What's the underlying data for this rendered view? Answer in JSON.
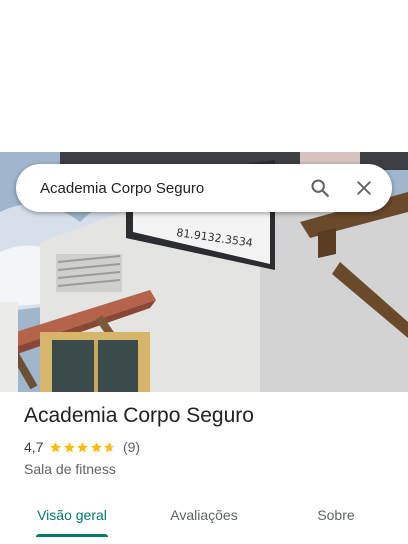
{
  "search": {
    "query": "Academia Corpo Seguro",
    "search_icon": "search-icon",
    "close_icon": "close-icon"
  },
  "photo": {
    "sign_text": "81.9132.3534"
  },
  "place": {
    "title": "Academia Corpo Seguro",
    "rating": "4,7",
    "stars": 4.7,
    "review_count": "(9)",
    "category": "Sala de fitness"
  },
  "tabs": [
    {
      "label": "Visão geral",
      "active": true
    },
    {
      "label": "Avaliações",
      "active": false
    },
    {
      "label": "Sobre",
      "active": false
    }
  ],
  "colors": {
    "accent": "#00796b",
    "star": "#fbbc04",
    "star_empty": "#dadce0"
  }
}
